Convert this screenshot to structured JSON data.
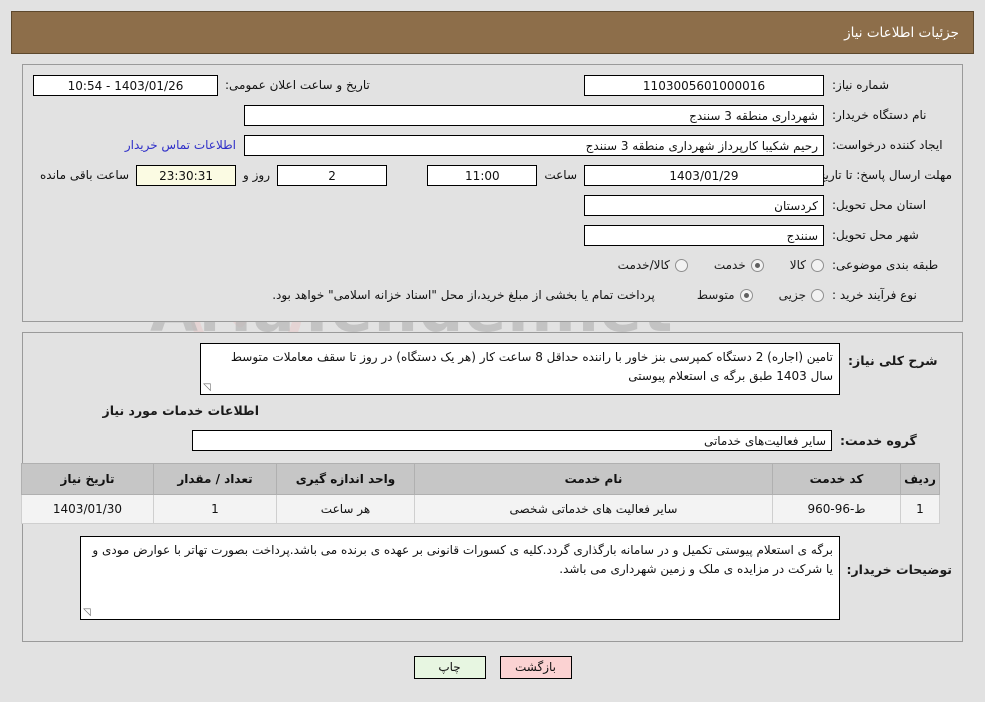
{
  "header": {
    "title": "جزئیات اطلاعات نیاز"
  },
  "form": {
    "need_number_label": "شماره نیاز:",
    "need_number_value": "1103005601000016",
    "public_announce_label": "تاریخ و ساعت اعلان عمومی:",
    "public_announce_value": "1403/01/26 - 10:54",
    "buyer_org_label": "نام دستگاه خریدار:",
    "buyer_org_value": "شهرداری منطقه 3 سنندج",
    "creator_label": "ایجاد کننده درخواست:",
    "creator_value": "رحیم شکیبا کارپرداز شهرداری منطقه 3 سنندج",
    "contact_link": "اطلاعات تماس خریدار",
    "deadline_label": "مهلت ارسال پاسخ: تا تاریخ:",
    "deadline_date": "1403/01/29",
    "hour_label": "ساعت",
    "hour_value": "11:00",
    "days_value": "2",
    "days_label": "روز و",
    "countdown_value": "23:30:31",
    "countdown_label": "ساعت باقی مانده",
    "province_label": "استان محل تحویل:",
    "province_value": "کردستان",
    "city_label": "شهر محل تحویل:",
    "city_value": "سنندج",
    "category_label": "طبقه بندی موضوعی:",
    "category_options": [
      {
        "label": "کالا",
        "selected": false
      },
      {
        "label": "خدمت",
        "selected": true
      },
      {
        "label": "کالا/خدمت",
        "selected": false
      }
    ],
    "process_label": "نوع فرآیند خرید :",
    "process_options": [
      {
        "label": "جزیی",
        "selected": false
      },
      {
        "label": "متوسط",
        "selected": true
      }
    ],
    "process_note": "پرداخت تمام یا بخشی از مبلغ خرید،از محل \"اسناد خزانه اسلامی\" خواهد بود."
  },
  "details": {
    "desc_label": "شرح کلی نیاز:",
    "desc_value": "تامین (اجاره) 2 دستگاه کمپرسی بنز خاور  با راننده  حداقل 8 ساعت کار (هر یک دستگاه) در روز تا سقف معاملات متوسط سال 1403 طبق برگه ی استعلام پیوستی",
    "services_section_title": "اطلاعات خدمات مورد نیاز",
    "service_group_label": "گروه خدمت:",
    "service_group_value": "سایر فعالیت‌های خدماتی",
    "notes_label": "توضیحات خریدار:",
    "notes_value": "برگه ی استعلام پیوستی تکمیل و در سامانه بارگذاری گردد.کلیه ی کسورات قانونی بر عهده ی برنده می باشد.پرداخت بصورت تهاتر با عوارض مودی و یا شرکت در مزایده ی ملک و زمین شهرداری می باشد."
  },
  "table": {
    "columns": [
      "ردیف",
      "کد خدمت",
      "نام خدمت",
      "واحد اندازه گیری",
      "تعداد / مقدار",
      "تاریخ نیاز"
    ],
    "rows": [
      {
        "row_no": "1",
        "code": "ط-96-960",
        "name": "سایر فعالیت های خدماتی شخصی",
        "unit": "هر ساعت",
        "qty": "1",
        "date": "1403/01/30"
      }
    ]
  },
  "buttons": {
    "back_label": "بازگشت",
    "print_label": "چاپ"
  },
  "watermark": {
    "text": "AriaTender.net"
  },
  "colors": {
    "header_bg": "#8d6e4a",
    "link": "#2f2fc8",
    "highlight_field": "#fbfbe3",
    "back_btn": "#fbd2d2",
    "print_btn": "#e7f6e1"
  }
}
